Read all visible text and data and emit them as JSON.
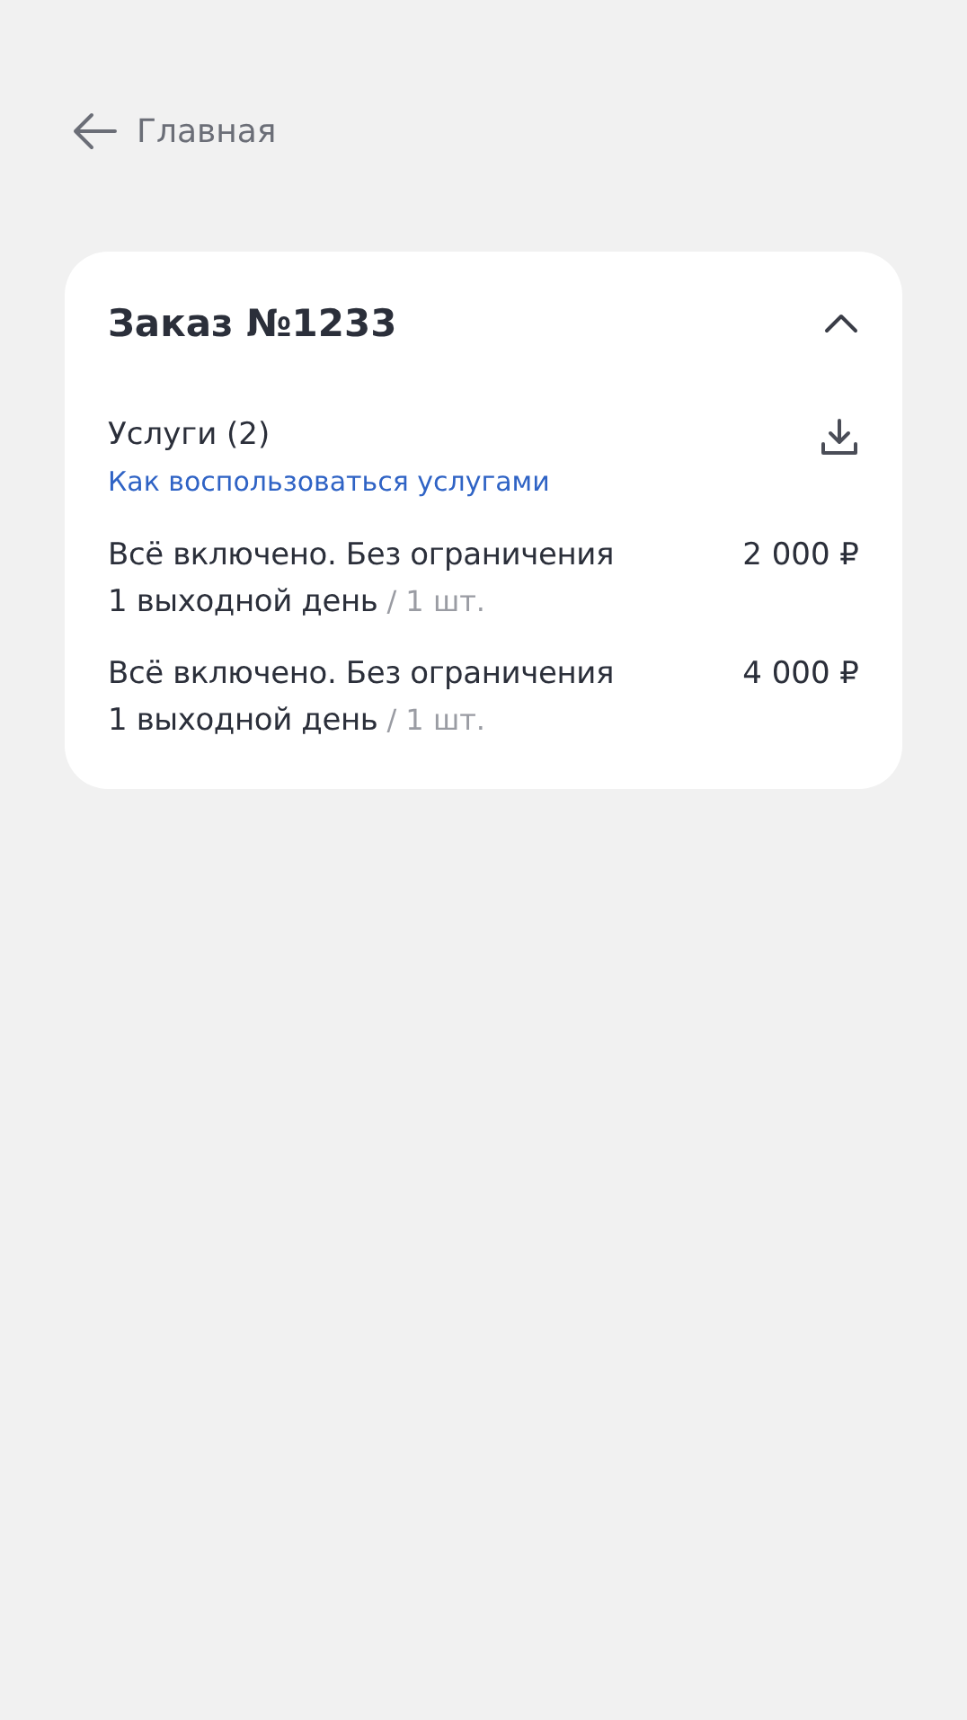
{
  "back_link": {
    "label": "Главная"
  },
  "order": {
    "title": "Заказ №1233",
    "expanded": true,
    "services": {
      "title": "Услуги (2)",
      "help_link": "Как воспользоваться услугами",
      "items": [
        {
          "name": "Всё включено. Без ограничения",
          "price": "2 000 ₽",
          "variant": "1 выходной день",
          "quantity": "/ 1 шт."
        },
        {
          "name": "Всё включено. Без ограничения",
          "price": "4 000 ₽",
          "variant": "1 выходной день",
          "quantity": "/ 1 шт."
        }
      ]
    }
  }
}
